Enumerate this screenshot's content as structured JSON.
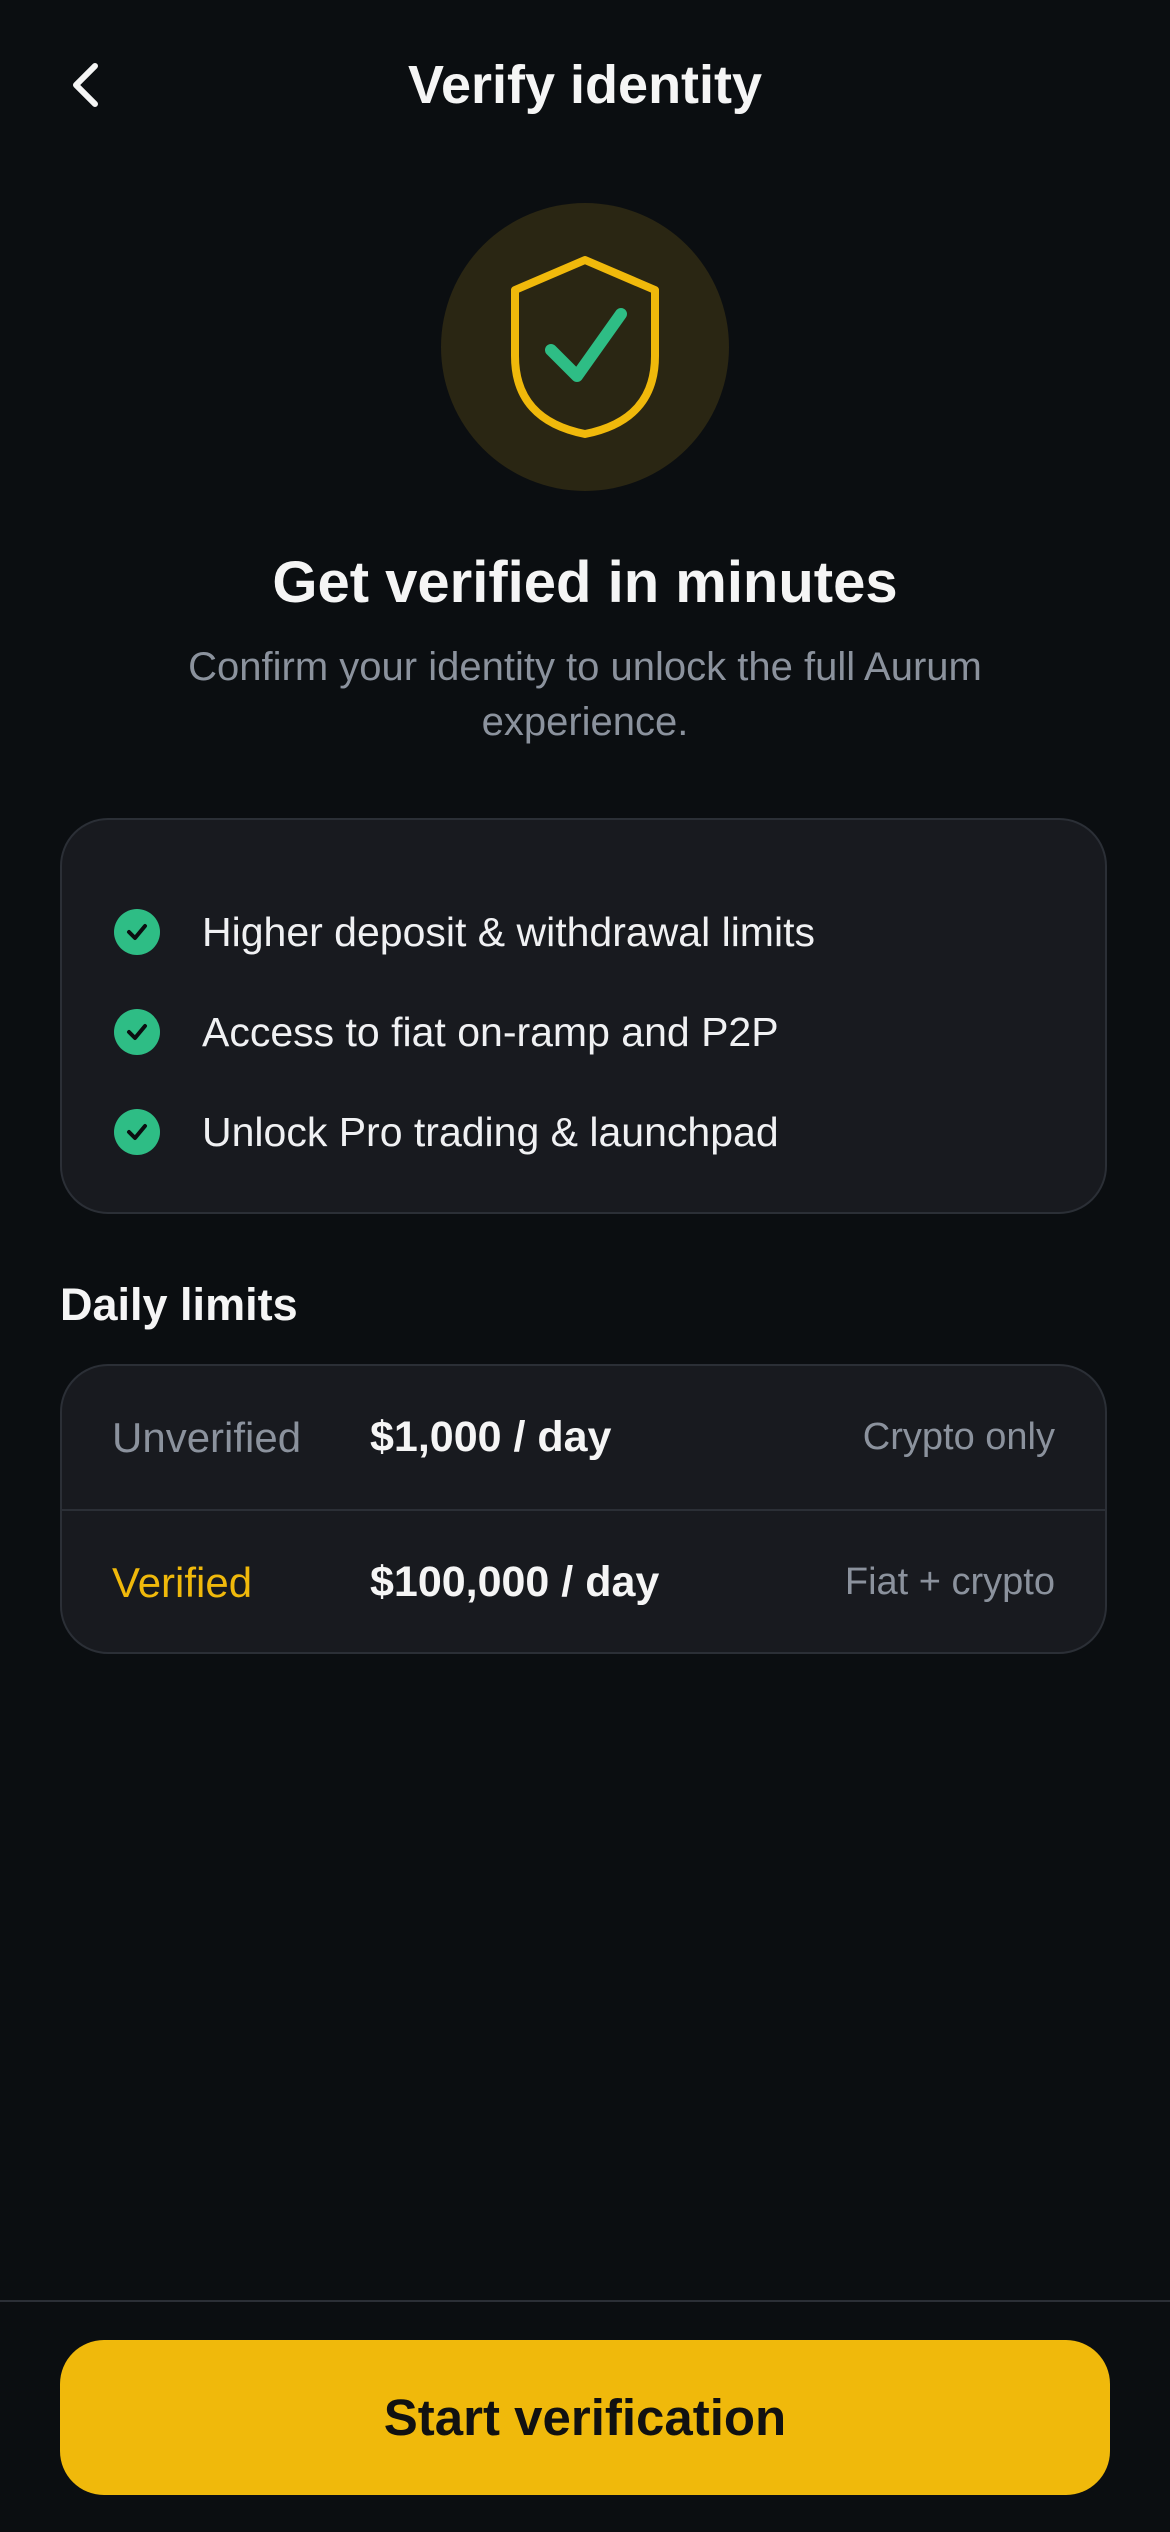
{
  "header": {
    "title": "Verify identity",
    "back_icon": "chevron-left-icon"
  },
  "hero": {
    "icon": "shield-check-icon",
    "headline": "Get verified in minutes",
    "subtext": "Confirm your identity to unlock the full Aurum experience."
  },
  "benefits": {
    "icon": "check-circle-icon",
    "items": [
      {
        "label": "Higher deposit & withdrawal limits"
      },
      {
        "label": "Access to fiat on-ramp and P2P"
      },
      {
        "label": "Unlock Pro trading & launchpad"
      }
    ]
  },
  "limits": {
    "title": "Daily limits",
    "rows": [
      {
        "tier": "Unverified",
        "amount": "$1,000 / day",
        "scope": "Crypto only"
      },
      {
        "tier": "Verified",
        "amount": "$100,000 / day",
        "scope": "Fiat + crypto"
      }
    ]
  },
  "cta": {
    "label": "Start verification"
  },
  "colors": {
    "background": "#0b0e11",
    "card": "#181a1f",
    "accent": "#f0b90b",
    "success": "#2ebd85",
    "muted_text": "#8b929d"
  }
}
